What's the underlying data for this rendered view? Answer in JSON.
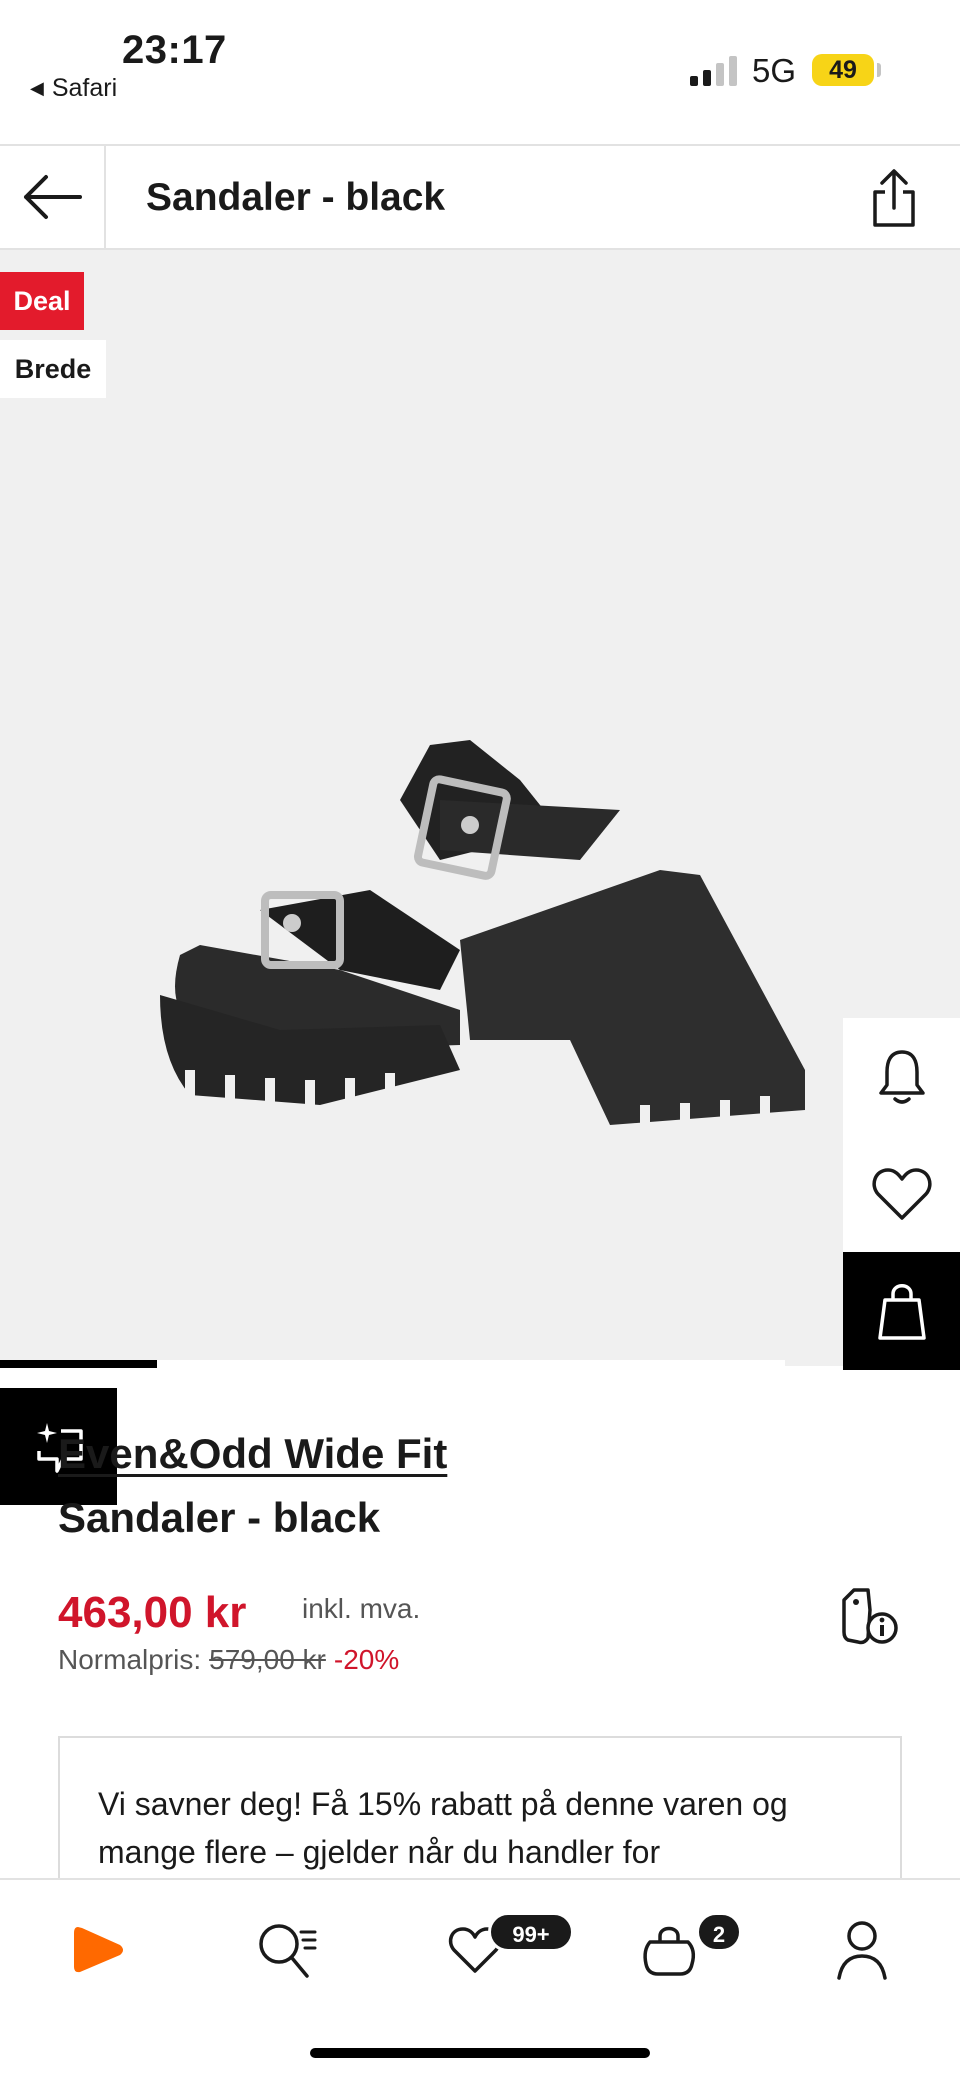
{
  "status_bar": {
    "time": "23:17",
    "back_app": "Safari",
    "network": "5G",
    "battery": "49",
    "colors": {
      "battery": "#f7d417"
    }
  },
  "header": {
    "title": "Sandaler - black",
    "back_icon": "arrow-left-icon",
    "share_icon": "share-icon"
  },
  "product_image": {
    "badges": {
      "deal": "Deal",
      "fit": "Brede"
    },
    "colors": {
      "deal": "#e31b2c",
      "background": "#f0f0f0"
    },
    "side_actions": [
      "bell-icon",
      "heart-icon",
      "bag-icon"
    ],
    "carousel": {
      "current": 1,
      "total": 5
    }
  },
  "product": {
    "brand": "Even&Odd Wide Fit",
    "name": "Sandaler - black",
    "price": "463,00 kr",
    "vat_note": "inkl. mva.",
    "normal_label": "Normalpris:",
    "normal_price": "579,00 kr",
    "discount": "-20%",
    "price_color": "#d0152b"
  },
  "promo": {
    "text": "Vi savner deg! Få 15% rabatt på denne varen og mange flere – gjelder når du handler for"
  },
  "bottom_nav": {
    "items": [
      "home-icon",
      "search-icon",
      "wishlist-icon",
      "cart-icon",
      "profile-icon"
    ],
    "wishlist_count": "99+",
    "cart_count": "2",
    "brand_color": "#ff6900"
  }
}
